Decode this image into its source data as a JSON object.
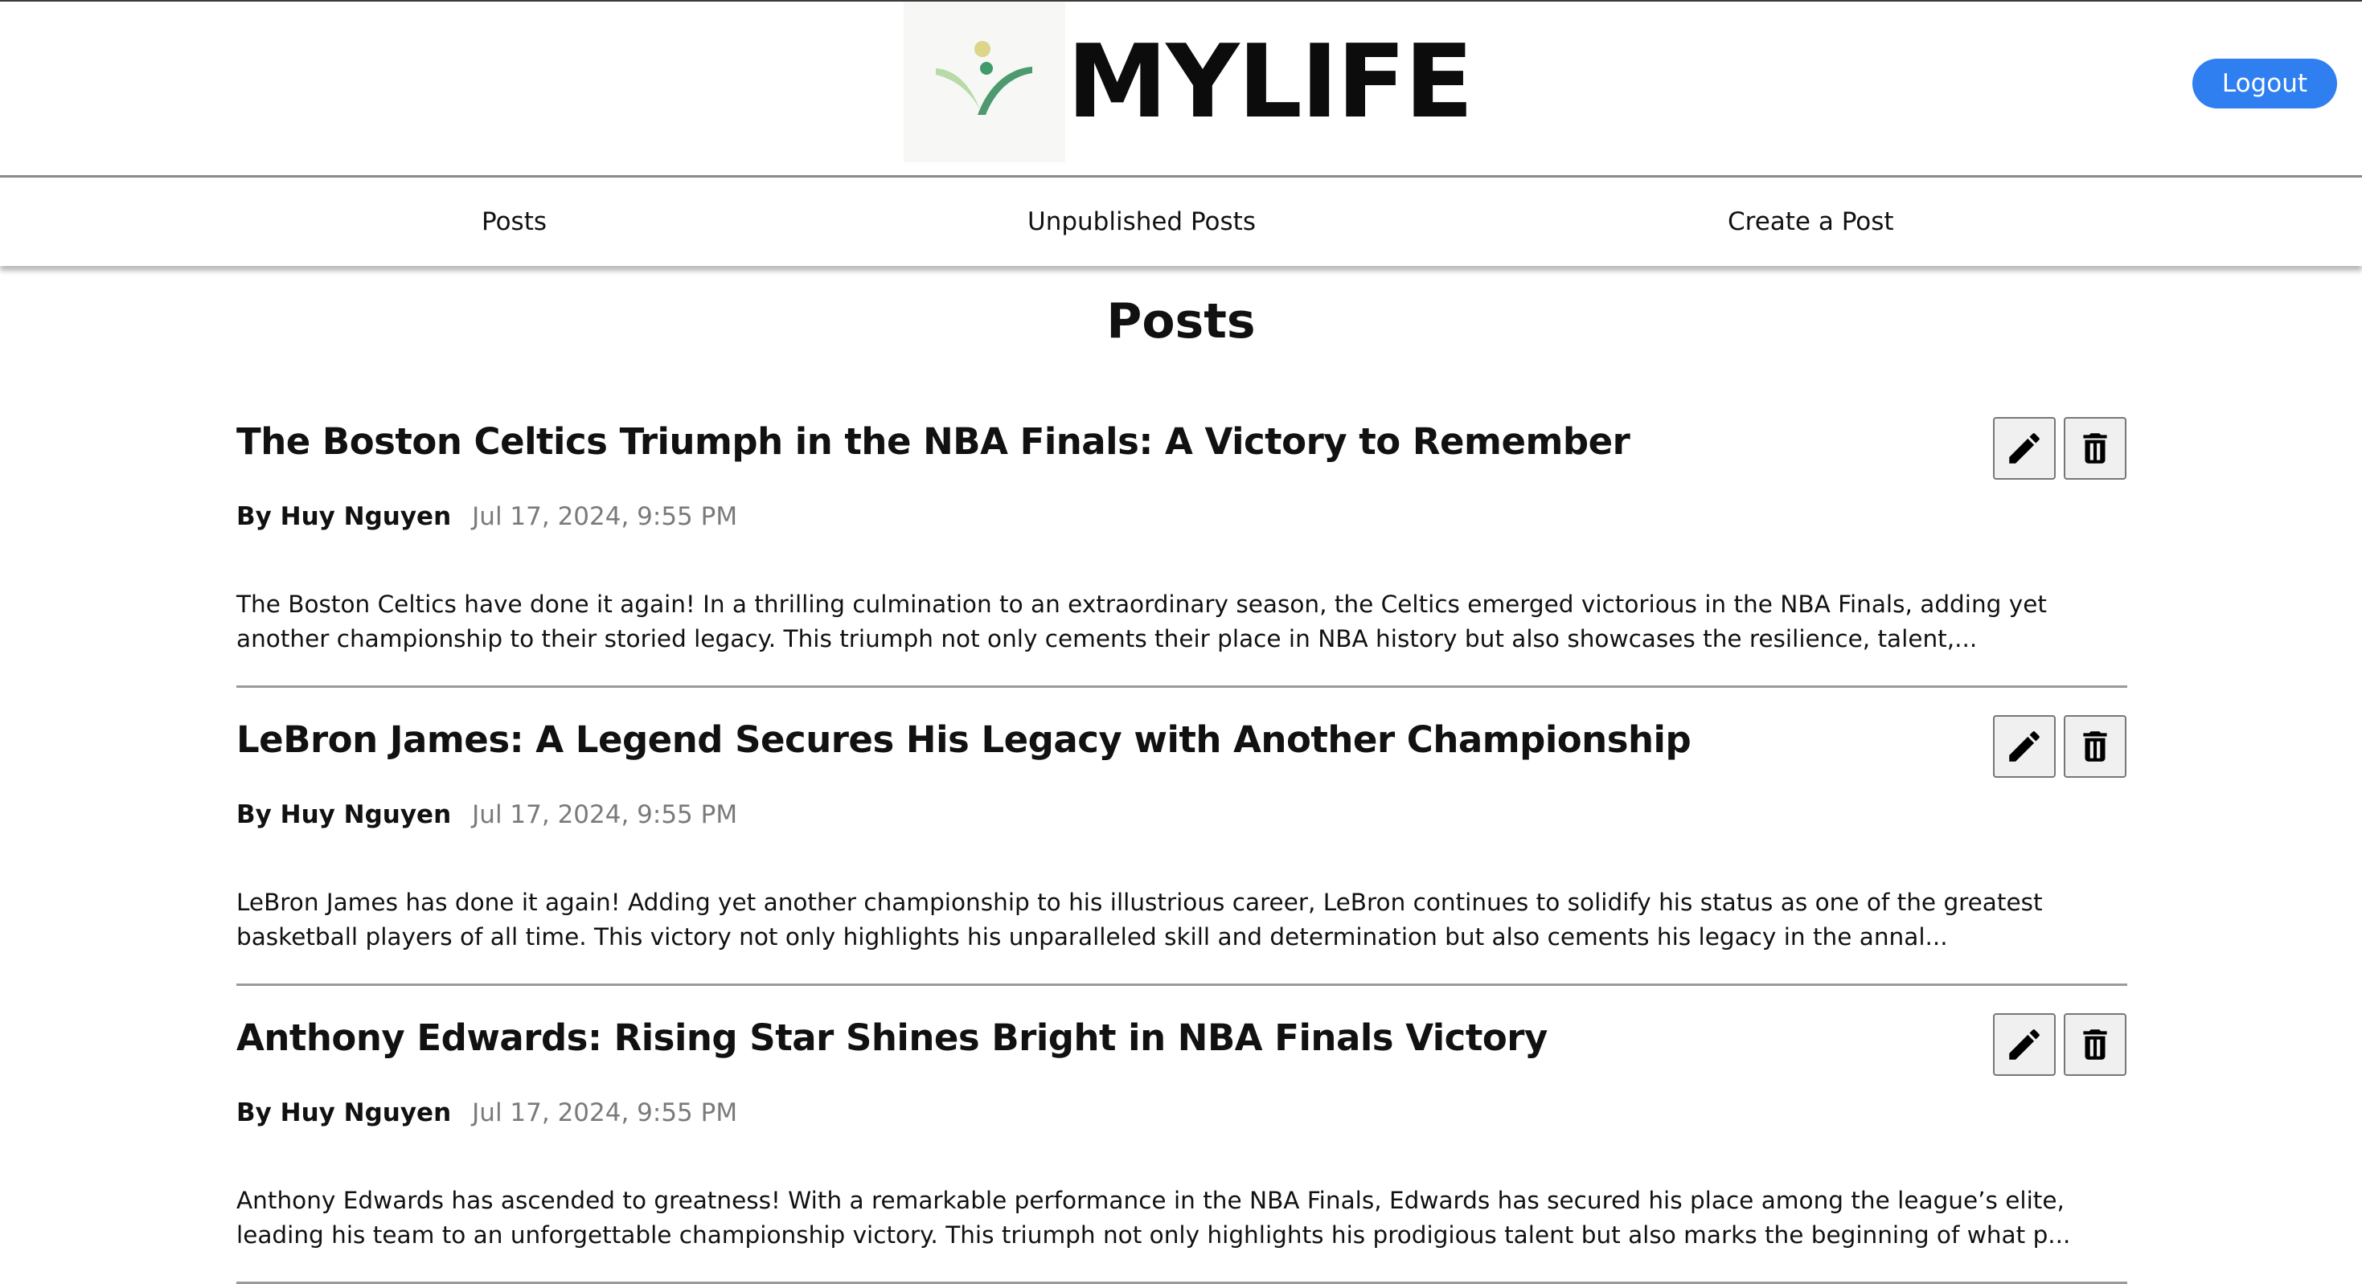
{
  "header": {
    "logo_text": "MYLIFE",
    "logout_label": "Logout",
    "colors": {
      "logout_button": "#2f7ff0",
      "logo_leaf_dark": "#4c9a6e",
      "logo_leaf_light": "#b8d9a8",
      "logo_dot_yellow": "#dcd58a",
      "logo_dot_green": "#3f9b6a"
    }
  },
  "nav": {
    "items": [
      {
        "label": "Posts"
      },
      {
        "label": "Unpublished Posts"
      },
      {
        "label": "Create a Post"
      }
    ]
  },
  "main": {
    "title": "Posts",
    "posts": [
      {
        "title": "The Boston Celtics Triumph in the NBA Finals: A Victory to Remember",
        "author": "By Huy Nguyen",
        "date": "Jul 17, 2024, 9:55 PM",
        "excerpt": "The Boston Celtics have done it again! In a thrilling culmination to an extraordinary season, the Celtics emerged victorious in the NBA Finals, adding yet another championship to their storied legacy. This triumph not only cements their place in NBA history but also showcases the resilience, talent,...",
        "edit_icon": "pencil-icon",
        "delete_icon": "trash-icon"
      },
      {
        "title": "LeBron James: A Legend Secures His Legacy with Another Championship",
        "author": "By Huy Nguyen",
        "date": "Jul 17, 2024, 9:55 PM",
        "excerpt": "LeBron James has done it again! Adding yet another championship to his illustrious career, LeBron continues to solidify his status as one of the greatest basketball players of all time. This victory not only highlights his unparalleled skill and determination but also cements his legacy in the annal...",
        "edit_icon": "pencil-icon",
        "delete_icon": "trash-icon"
      },
      {
        "title": "Anthony Edwards: Rising Star Shines Bright in NBA Finals Victory",
        "author": "By Huy Nguyen",
        "date": "Jul 17, 2024, 9:55 PM",
        "excerpt": "Anthony Edwards has ascended to greatness! With a remarkable performance in the NBA Finals, Edwards has secured his place among the league’s elite, leading his team to an unforgettable championship victory. This triumph not only highlights his prodigious talent but also marks the beginning of what p...",
        "edit_icon": "pencil-icon",
        "delete_icon": "trash-icon"
      }
    ]
  }
}
